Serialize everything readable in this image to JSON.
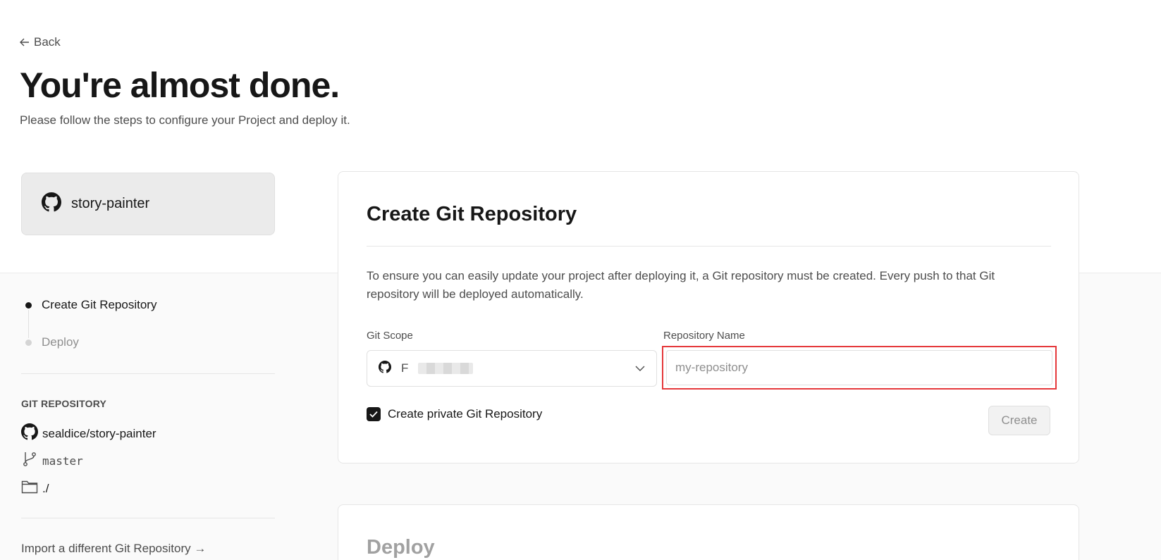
{
  "header": {
    "back_label": "Back",
    "title": "You're almost done.",
    "subtitle": "Please follow the steps to configure your Project and deploy it."
  },
  "repo_chip": {
    "name": "story-painter",
    "icon": "github-icon"
  },
  "steps": [
    {
      "label": "Create Git Repository",
      "active": true
    },
    {
      "label": "Deploy",
      "active": false
    }
  ],
  "git_repository": {
    "section_label": "GIT REPOSITORY",
    "repo": "sealdice/story-painter",
    "branch": "master",
    "root_dir": "./"
  },
  "import_link": "Import a different Git Repository →",
  "create_card": {
    "title": "Create Git Repository",
    "description": "To ensure you can easily update your project after deploying it, a Git repository must be created. Every push to that Git repository will be deployed automatically.",
    "scope_label": "Git Scope",
    "scope_value": "F",
    "repo_name_label": "Repository Name",
    "repo_name_placeholder": "my-repository",
    "private_label": "Create private Git Repository",
    "private_checked": true,
    "create_label": "Create"
  },
  "deploy_card": {
    "title": "Deploy"
  },
  "colors": {
    "highlight_border": "#e5383b",
    "text_primary": "#171717",
    "text_secondary": "#4d4d4d"
  }
}
